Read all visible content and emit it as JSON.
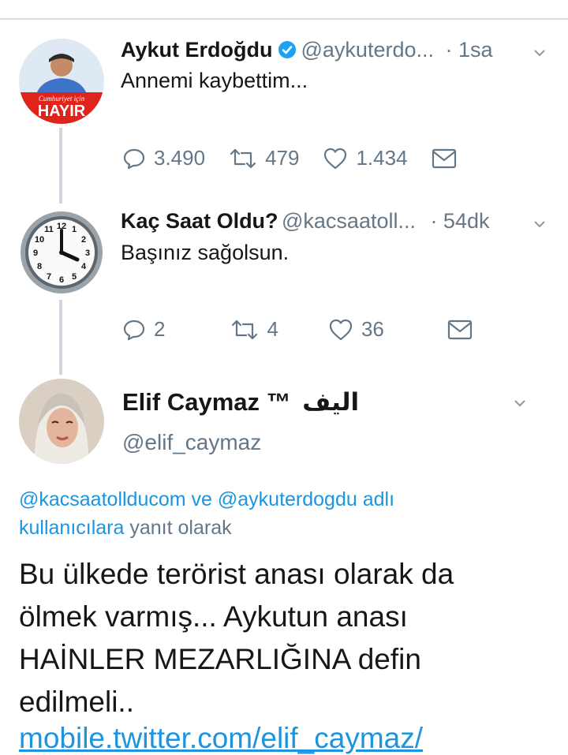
{
  "tweets": [
    {
      "name": "Aykut Erdoğdu",
      "handle": "@aykuterdo...",
      "time": "· 1sa",
      "text": "Annemi kaybettim...",
      "avatar_text_top": "Cumhuriyet için",
      "avatar_text_bottom": "HAYIR",
      "replies": "3.490",
      "retweets": "479",
      "likes": "1.434"
    },
    {
      "name": "Kaç Saat Oldu?",
      "handle": "@kacsaatoll...",
      "time": "· 54dk",
      "text": "Başınız sağolsun.",
      "replies": "2",
      "retweets": "4",
      "likes": "36"
    }
  ],
  "main_tweet": {
    "name": "Elif Caymaz ™",
    "name_arabic": "اليف",
    "handle": "@elif_caymaz",
    "reply_mentions_1": "@kacsaatollducom ve @aykuterdogdu adlı",
    "reply_mentions_2": "kullanıcılara",
    "reply_suffix": "yanıt olarak",
    "text_line_1": "Bu ülkede terörist anası olarak da",
    "text_line_2": "ölmek varmış... Aykutun anası",
    "text_line_3": "HAİNLER MEZARLIĞINA defin",
    "text_line_4": "edilmeli..",
    "link": "mobile.twitter.com/elif_caymaz/"
  },
  "colors": {
    "link": "#1b95e0",
    "secondary_text": "#657786",
    "verified": "#1da1f2",
    "avatar_red": "#e0241b"
  }
}
